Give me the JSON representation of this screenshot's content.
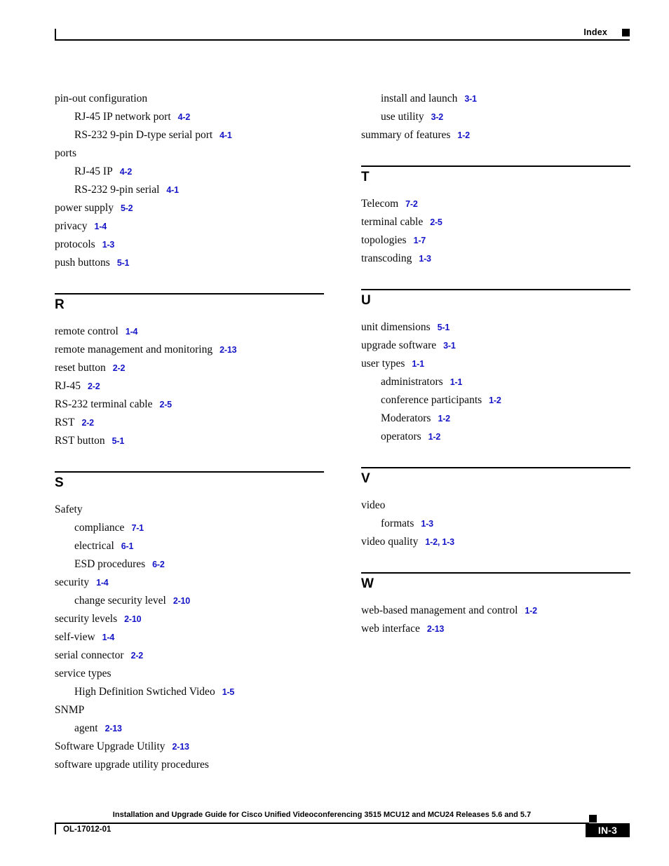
{
  "header": {
    "label": "Index",
    "marker_icon": "black-square-marker"
  },
  "colors": {
    "page_reference_blue": "#1414c8",
    "text_black": "#000000"
  },
  "columns": {
    "left": [
      {
        "letter": "",
        "has_rule": false,
        "entries": [
          {
            "level": 1,
            "term": "pin-out configuration",
            "ref": ""
          },
          {
            "level": 2,
            "term": "RJ-45 IP network port",
            "ref": "4-2"
          },
          {
            "level": 2,
            "term": "RS-232 9-pin D-type serial port",
            "ref": "4-1"
          },
          {
            "level": 1,
            "term": "ports",
            "ref": ""
          },
          {
            "level": 2,
            "term": "RJ-45 IP",
            "ref": "4-2"
          },
          {
            "level": 2,
            "term": "RS-232 9-pin serial",
            "ref": "4-1"
          },
          {
            "level": 1,
            "term": "power supply",
            "ref": "5-2"
          },
          {
            "level": 1,
            "term": "privacy",
            "ref": "1-4"
          },
          {
            "level": 1,
            "term": "protocols",
            "ref": "1-3"
          },
          {
            "level": 1,
            "term": "push buttons",
            "ref": "5-1"
          }
        ]
      },
      {
        "letter": "R",
        "has_rule": true,
        "entries": [
          {
            "level": 1,
            "term": "remote control",
            "ref": "1-4"
          },
          {
            "level": 1,
            "term": "remote management and monitoring",
            "ref": "2-13"
          },
          {
            "level": 1,
            "term": "reset button",
            "ref": "2-2"
          },
          {
            "level": 1,
            "term": "RJ-45",
            "ref": "2-2"
          },
          {
            "level": 1,
            "term": "RS-232 terminal cable",
            "ref": "2-5"
          },
          {
            "level": 1,
            "term": "RST",
            "ref": "2-2"
          },
          {
            "level": 1,
            "term": "RST button",
            "ref": "5-1"
          }
        ]
      },
      {
        "letter": "S",
        "has_rule": true,
        "entries": [
          {
            "level": 1,
            "term": "Safety",
            "ref": ""
          },
          {
            "level": 2,
            "term": "compliance",
            "ref": "7-1"
          },
          {
            "level": 2,
            "term": "electrical",
            "ref": "6-1"
          },
          {
            "level": 2,
            "term": "ESD procedures",
            "ref": "6-2"
          },
          {
            "level": 1,
            "term": "security",
            "ref": "1-4"
          },
          {
            "level": 2,
            "term": "change security level",
            "ref": "2-10"
          },
          {
            "level": 1,
            "term": "security levels",
            "ref": "2-10"
          },
          {
            "level": 1,
            "term": "self-view",
            "ref": "1-4"
          },
          {
            "level": 1,
            "term": "serial connector",
            "ref": "2-2"
          },
          {
            "level": 1,
            "term": "service types",
            "ref": ""
          },
          {
            "level": 2,
            "term": "High Definition Swtiched Video",
            "ref": "1-5"
          },
          {
            "level": 1,
            "term": "SNMP",
            "ref": ""
          },
          {
            "level": 2,
            "term": "agent",
            "ref": "2-13"
          },
          {
            "level": 1,
            "term": "Software Upgrade Utility",
            "ref": "2-13"
          },
          {
            "level": 1,
            "term": "software upgrade utility procedures",
            "ref": ""
          }
        ]
      }
    ],
    "right": [
      {
        "letter": "",
        "has_rule": false,
        "entries": [
          {
            "level": 2,
            "term": "install and launch",
            "ref": "3-1"
          },
          {
            "level": 2,
            "term": "use utility",
            "ref": "3-2"
          },
          {
            "level": 1,
            "term": "summary of features",
            "ref": "1-2"
          }
        ]
      },
      {
        "letter": "T",
        "has_rule": true,
        "entries": [
          {
            "level": 1,
            "term": "Telecom",
            "ref": "7-2"
          },
          {
            "level": 1,
            "term": "terminal cable",
            "ref": "2-5"
          },
          {
            "level": 1,
            "term": "topologies",
            "ref": "1-7"
          },
          {
            "level": 1,
            "term": "transcoding",
            "ref": "1-3"
          }
        ]
      },
      {
        "letter": "U",
        "has_rule": true,
        "entries": [
          {
            "level": 1,
            "term": "unit dimensions",
            "ref": "5-1"
          },
          {
            "level": 1,
            "term": "upgrade software",
            "ref": "3-1"
          },
          {
            "level": 1,
            "term": "user types",
            "ref": "1-1"
          },
          {
            "level": 2,
            "term": "administrators",
            "ref": "1-1"
          },
          {
            "level": 2,
            "term": "conference participants",
            "ref": "1-2"
          },
          {
            "level": 2,
            "term": "Moderators",
            "ref": "1-2"
          },
          {
            "level": 2,
            "term": "operators",
            "ref": "1-2"
          }
        ]
      },
      {
        "letter": "V",
        "has_rule": true,
        "entries": [
          {
            "level": 1,
            "term": "video",
            "ref": ""
          },
          {
            "level": 2,
            "term": "formats",
            "ref": "1-3"
          },
          {
            "level": 1,
            "term": "video quality",
            "ref": "1-2, 1-3"
          }
        ]
      },
      {
        "letter": "W",
        "has_rule": true,
        "entries": [
          {
            "level": 1,
            "term": "web-based management and control",
            "ref": "1-2"
          },
          {
            "level": 1,
            "term": "web interface",
            "ref": "2-13"
          }
        ]
      }
    ]
  },
  "footer": {
    "title": "Installation and Upgrade Guide for Cisco Unified Videoconferencing 3515 MCU12 and MCU24 Releases 5.6 and 5.7",
    "doc_number": "OL-17012-01",
    "page_number": "IN-3"
  }
}
